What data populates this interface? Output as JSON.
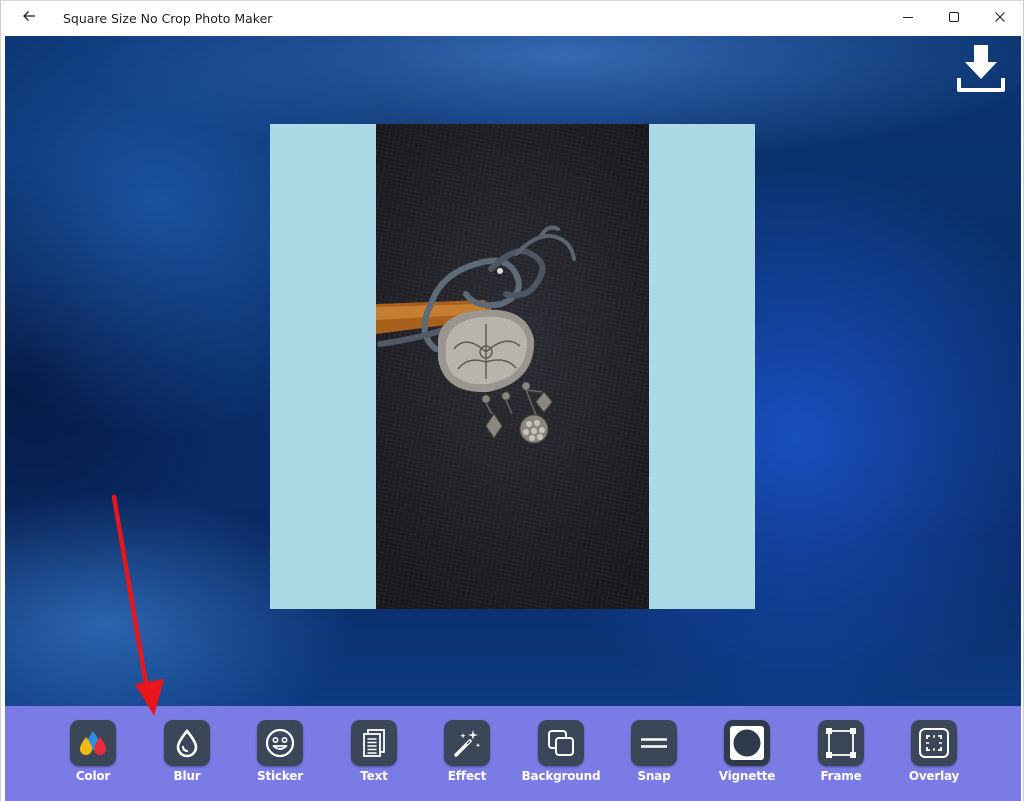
{
  "window": {
    "title": "Square Size No Crop Photo Maker"
  },
  "icons": {
    "back": "back-arrow-icon",
    "minimize": "minimize-icon",
    "maximize": "maximize-icon",
    "close": "close-icon",
    "download": "download-icon"
  },
  "canvas": {
    "square_color": "#add8e6",
    "photo_subject": "silver pendant necklace on dark fabric"
  },
  "toolbar": {
    "background": "#7b7be5",
    "tools": [
      {
        "label": "Color",
        "icon": "color-drops-icon"
      },
      {
        "label": "Blur",
        "icon": "blur-drop-icon"
      },
      {
        "label": "Sticker",
        "icon": "sticker-smiley-icon"
      },
      {
        "label": "Text",
        "icon": "text-document-icon"
      },
      {
        "label": "Effect",
        "icon": "magic-wand-icon"
      },
      {
        "label": "Background",
        "icon": "background-layers-icon"
      },
      {
        "label": "Snap",
        "icon": "snap-lines-icon"
      },
      {
        "label": "Vignette",
        "icon": "vignette-icon"
      },
      {
        "label": "Frame",
        "icon": "frame-icon"
      },
      {
        "label": "Overlay",
        "icon": "overlay-icon"
      }
    ]
  },
  "annotation": {
    "arrow_color": "#e8161b",
    "points_to": "Blur"
  }
}
